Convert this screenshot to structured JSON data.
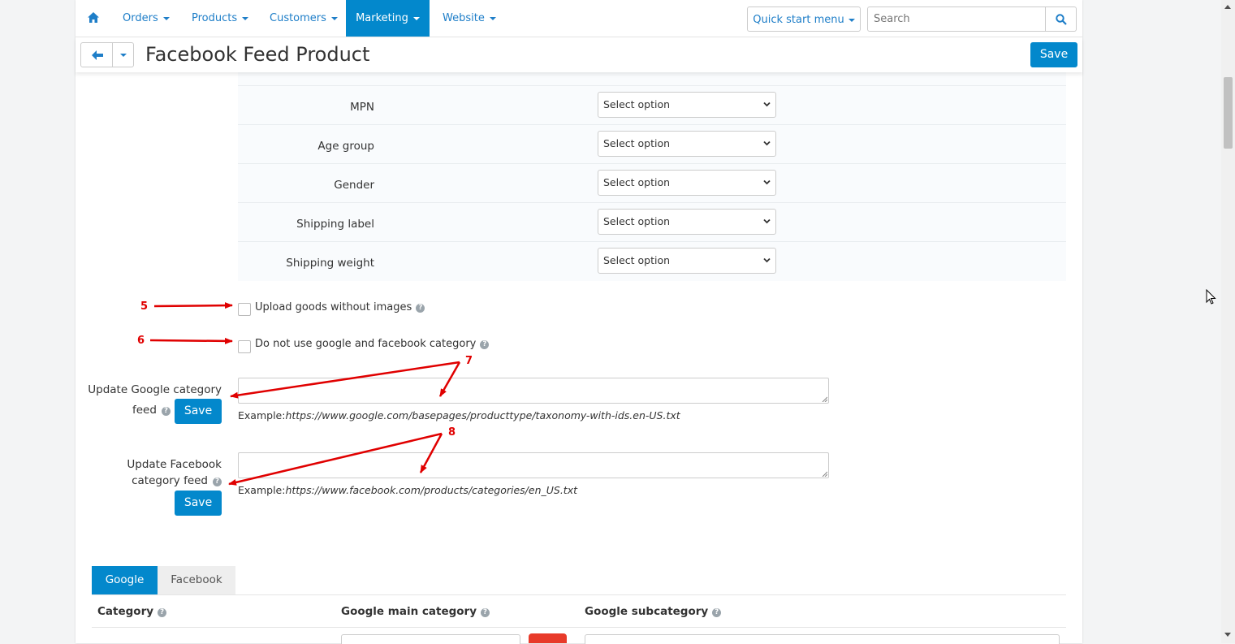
{
  "nav": {
    "items": [
      {
        "label": "Orders"
      },
      {
        "label": "Products"
      },
      {
        "label": "Customers"
      },
      {
        "label": "Marketing"
      },
      {
        "label": "Website"
      }
    ],
    "quick_start": "Quick start menu",
    "search_placeholder": "Search"
  },
  "header": {
    "title": "Facebook Feed Product",
    "save_label": "Save"
  },
  "mapping_rows": [
    {
      "label": "MPN",
      "value": "Select option"
    },
    {
      "label": "Age group",
      "value": "Select option"
    },
    {
      "label": "Gender",
      "value": "Select option"
    },
    {
      "label": "Shipping label",
      "value": "Select option"
    },
    {
      "label": "Shipping weight",
      "value": "Select option"
    }
  ],
  "options": {
    "upload_without_images": {
      "label": "Upload goods without images",
      "checked": false
    },
    "no_google_fb_category": {
      "label": "Do not use google and facebook category",
      "checked": false
    }
  },
  "google_feed": {
    "label_line1": "Update Google category",
    "label_line2": "feed",
    "save_label": "Save",
    "example_prefix": "Example:",
    "example_url": "https://www.google.com/basepages/producttype/taxonomy-with-ids.en-US.txt"
  },
  "facebook_feed": {
    "label_line1": "Update Facebook",
    "label_line2": "category feed",
    "save_label": "Save",
    "example_prefix": "Example:",
    "example_url": "https://www.facebook.com/products/categories/en_US.txt"
  },
  "annotations": [
    "5",
    "6",
    "7",
    "8"
  ],
  "tabs": [
    {
      "label": "Google",
      "active": true
    },
    {
      "label": "Facebook",
      "active": false
    }
  ],
  "table_headers": [
    "Category",
    "Google main category",
    "Google subcategory"
  ],
  "colors": {
    "accent": "#0388cc",
    "annotation": "#e00000"
  }
}
